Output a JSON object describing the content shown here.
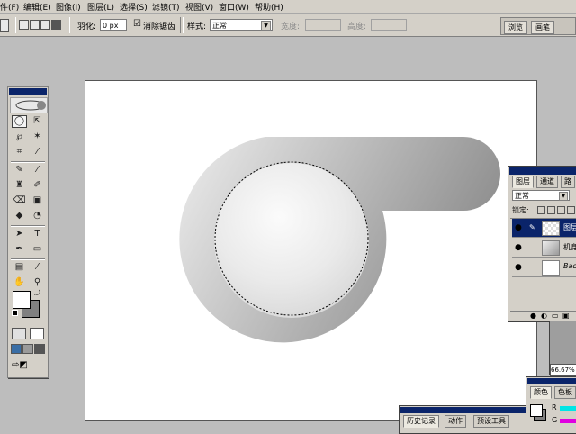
{
  "menubar": {
    "items": [
      "件(F)",
      "编辑(E)",
      "图像(I)",
      "图层(L)",
      "选择(S)",
      "滤镜(T)",
      "视图(V)",
      "窗口(W)",
      "帮助(H)"
    ]
  },
  "options": {
    "feather_label": "羽化:",
    "feather_value": "0 px",
    "checkbox_mark": "☑",
    "antialias_label": "消除锯齿",
    "style_label": "样式:",
    "style_value": "正常",
    "width_label": "宽度:",
    "height_label": "高度:"
  },
  "palette_well": {
    "tabs": [
      "浏览",
      "画笔"
    ]
  },
  "layers_panel": {
    "tabs": [
      "图层",
      "通道",
      "路"
    ],
    "blend_mode": "正常",
    "lock_label": "锁定:",
    "layers": [
      {
        "name": "图层",
        "selected": true
      },
      {
        "name": "机身",
        "selected": false
      },
      {
        "name": "Background",
        "selected": false
      }
    ]
  },
  "zoom": {
    "value": "66.67%"
  },
  "history_panel": {
    "tabs": [
      "历史记录",
      "动作",
      "预设工具"
    ]
  },
  "color_panel": {
    "tabs": [
      "颜色",
      "色板"
    ],
    "channels": [
      "R",
      "G"
    ]
  },
  "colors": {
    "ui": "#d4d0c8",
    "workspace": "#bdbdbd",
    "title_blue": "#0a246a",
    "r_slider": "#00e5e5",
    "g_slider": "#e000e0"
  }
}
